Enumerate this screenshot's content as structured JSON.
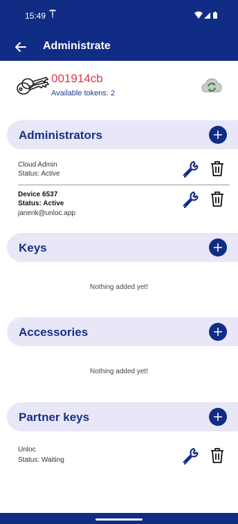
{
  "status_bar": {
    "time": "15:49",
    "carrier_icon": "tesla-icon",
    "system_icons": [
      "wifi-icon",
      "signal-icon",
      "battery-icon"
    ]
  },
  "app_bar": {
    "title": "Administrate",
    "back_icon": "arrow-left-icon"
  },
  "device": {
    "id": "001914cb",
    "tokens_label": "Available tokens:",
    "tokens_value": "2",
    "icon": "keys-icon",
    "sync_icon": "cloud-sync-icon"
  },
  "sections": {
    "administrators": {
      "title": "Administrators",
      "items": [
        {
          "name": "Cloud Admin",
          "status": "Status: Active"
        },
        {
          "name": "Device 6537",
          "status": "Status: Active",
          "email": "janerik@unloc.app"
        }
      ]
    },
    "keys": {
      "title": "Keys",
      "empty_text": "Nothing added yet!"
    },
    "accessories": {
      "title": "Accessories",
      "empty_text": "Nothing added yet!"
    },
    "partner_keys": {
      "title": "Partner keys",
      "items": [
        {
          "name": "Unloc",
          "status": "Status: Waiting"
        }
      ]
    }
  },
  "colors": {
    "primary": "#102c84",
    "accent_red": "#e0334c",
    "section_bg": "#e7e7f8",
    "sync_green": "#2e8b3a"
  }
}
